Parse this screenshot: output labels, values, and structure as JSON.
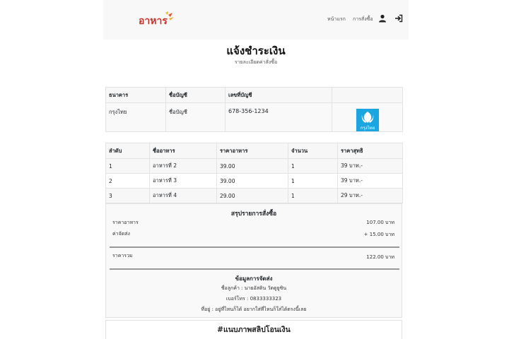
{
  "brand": {
    "logo_text": "อาหาร",
    "colors": {
      "logo_main": "#c9332a",
      "logo_accent": "#f2b233"
    }
  },
  "nav": {
    "links": [
      "หน้าแรก",
      "การสั่งซื้อ"
    ],
    "icons": [
      "user-icon",
      "sign-in-icon"
    ]
  },
  "page": {
    "title": "แจ้งชำระเงิน",
    "subtitle": "รายละเอียดค่าสั่งซื้อ"
  },
  "bank_table": {
    "headers": [
      "ธนาคาร",
      "ชื่อบัญชี",
      "เลขที่บัญชี",
      ""
    ],
    "row": {
      "bank": "กรุงไทย",
      "account_name": "ชื่อบัญชี",
      "account_number": "678-356-1234",
      "logo_label": "กรุงไทย"
    },
    "logo_color": "#1ba5e1"
  },
  "order_table": {
    "headers": [
      "ลำดับ",
      "ชื่ออาหาร",
      "ราคาอาหาร",
      "จำนวน",
      "ราคาสุทธิ"
    ],
    "rows": [
      [
        "1",
        "อาหารที่ 2",
        "39.00",
        "1",
        "39 บาท.-"
      ],
      [
        "2",
        "อาหารที่ 3",
        "39.00",
        "1",
        "39 บาท.-"
      ],
      [
        "3",
        "อาหารที่ 4",
        "29.00",
        "1",
        "29 บาท.-"
      ]
    ]
  },
  "summary": {
    "title": "สรุปรายการสั่งซื้อ",
    "food_price_label": "ราคาอาหาร",
    "food_price_value": "107.00 บาท",
    "shipping_label": "ค่าจัดส่ง",
    "shipping_value": "+ 15.00 บาท",
    "total_label": "ราคารวม",
    "total_value": "122.00 บาท"
  },
  "shipping": {
    "title": "ข้อมูลการจัดส่ง",
    "customer": "ชื่อลูกค้า : นายอัสติน วัตตูยูซิน",
    "phone": "เบอร์โทร : 0833333323",
    "address": "ที่อยู่ : อยู่ที่ไหนก็ได้ อยากใส่ที่ไหนก็ใส่ได้ตรงนี้เลย"
  },
  "slip": {
    "title": "#แนบภาพสลิปโอนเงิน"
  }
}
